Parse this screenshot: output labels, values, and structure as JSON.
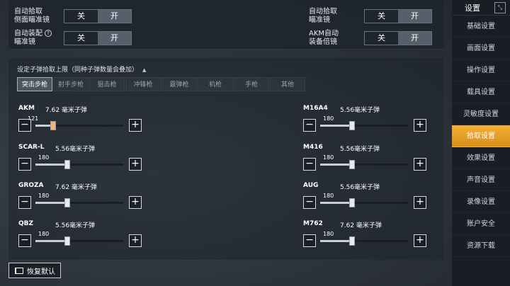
{
  "toggles": [
    {
      "label_line1": "自动拾取",
      "label_line2": "侧面瞄准镜",
      "off": "关",
      "on": "开",
      "help": ""
    },
    {
      "label_line1": "自动拾取",
      "label_line2": "瞄准镜",
      "off": "关",
      "on": "开",
      "help": ""
    },
    {
      "label_line1": "自动装配",
      "label_line2": "瞄准镜",
      "off": "关",
      "on": "开",
      "help": "?"
    },
    {
      "label_line1": "AKM自动",
      "label_line2": "装备倍镜",
      "off": "关",
      "on": "开",
      "help": ""
    }
  ],
  "section": {
    "title": "设定子弹拾取上限（同种子弹数量会叠加）",
    "caret": "▲"
  },
  "tabs": [
    "突击步枪",
    "射手步枪",
    "狙击枪",
    "冲锋枪",
    "霰弹枪",
    "机枪",
    "手枪",
    "其他"
  ],
  "weapons": [
    {
      "name": "AKM",
      "ammo": "7.62 毫米子弹",
      "value": "121",
      "level": 0.2
    },
    {
      "name": "M16A4",
      "ammo": "5.56毫米子弹",
      "value": "180",
      "level": 0.36
    },
    {
      "name": "SCAR-L",
      "ammo": "5.56毫米子弹",
      "value": "180",
      "level": 0.36
    },
    {
      "name": "M416",
      "ammo": "5.56毫米子弹",
      "value": "180",
      "level": 0.36
    },
    {
      "name": "GROZA",
      "ammo": "7.62 毫米子弹",
      "value": "180",
      "level": 0.36
    },
    {
      "name": "AUG",
      "ammo": "5.56毫米子弹",
      "value": "180",
      "level": 0.36
    },
    {
      "name": "QBZ",
      "ammo": "5.56毫米子弹",
      "value": "180",
      "level": 0.36
    },
    {
      "name": "M762",
      "ammo": "7.62 毫米子弹",
      "value": "180",
      "level": 0.36
    }
  ],
  "stepper": {
    "minus": "−",
    "plus": "+"
  },
  "reset_label": "恢复默认",
  "sidebar": {
    "title": "设置",
    "items": [
      "基础设置",
      "画面设置",
      "操作设置",
      "载具设置",
      "灵敏度设置",
      "拾取设置",
      "效果设置",
      "声音设置",
      "录像设置",
      "账户安全",
      "资源下载"
    ],
    "active_index": 5
  },
  "colors": {
    "accent": "#f0a830",
    "panel": "#1e242c"
  }
}
